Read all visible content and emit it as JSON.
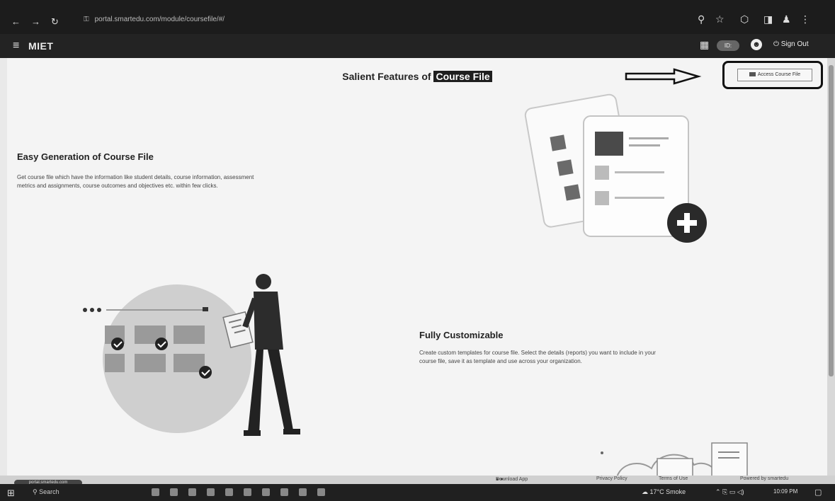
{
  "browser": {
    "url": "portal.smartedu.com/module/coursefile/#/",
    "nav_back": "←",
    "nav_forward": "→",
    "nav_reload": "↻"
  },
  "app": {
    "brand": "MIET",
    "badge": "ID:",
    "signout_label": "Sign Out"
  },
  "main": {
    "title_prefix": "Salient Features of ",
    "title_highlight": "Course File",
    "access_button_label": "Access Course File",
    "features": [
      {
        "heading": "Easy Generation of Course File",
        "text_line1": "Get course file which have the information like student details, course information, assessment",
        "text_line2": "metrics and assignments, course outcomes and objectives etc. within few clicks."
      },
      {
        "heading": "Fully Customizable",
        "text_line1": "Create custom templates for course file. Select the details (reports) you want to include in your",
        "text_line2": "course file, save it as template and use across your organization."
      }
    ]
  },
  "footer": {
    "download_app": "Download App",
    "privacy_policy": "Privacy Policy",
    "terms": "Terms of Use",
    "powered_by": "Powered by smartedu",
    "status_text": "portal.smartedu.com"
  },
  "taskbar": {
    "search_label": "Search",
    "weather": "17°C Smoke",
    "clock": "10:09 PM"
  },
  "colors": {
    "browser_bg": "#1c1c1c",
    "appbar_bg": "#232323",
    "page_bg": "#f4f4f4",
    "highlight_bg": "#1f1f1f"
  }
}
